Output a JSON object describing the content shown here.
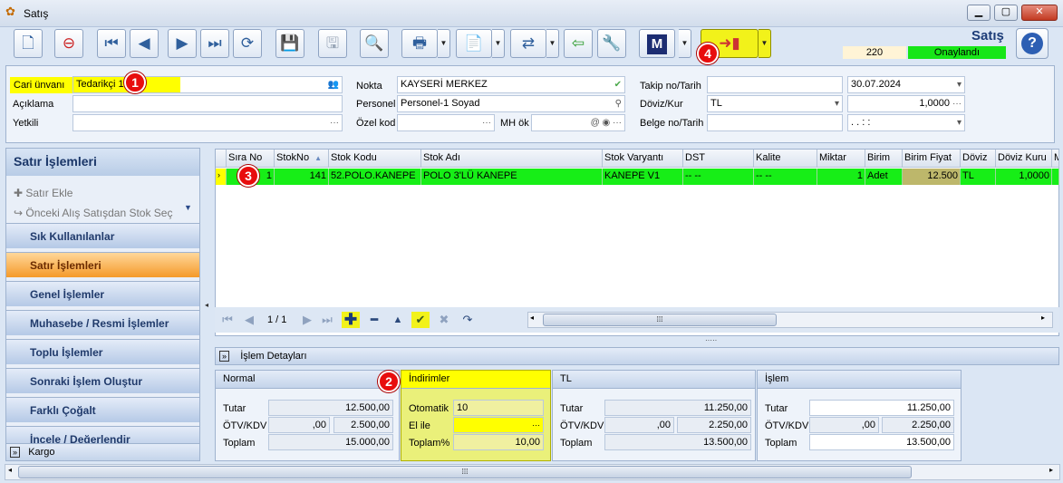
{
  "window": {
    "title": "Satış",
    "minimize": "▁",
    "maximize": "▢",
    "close": "✕"
  },
  "toolbar": {
    "doc_title": "Satış",
    "status_number": "220",
    "status_label": "Onaylandı",
    "m_label": "M",
    "help": "?"
  },
  "header": {
    "cari_label": "Cari ünvanı",
    "cari_value": "Tedarikçi 1",
    "aciklama_label": "Açıklama",
    "aciklama_value": "",
    "yetkili_label": "Yetkili",
    "yetkili_value": "",
    "nokta_label": "Nokta",
    "nokta_value": "KAYSERİ MERKEZ",
    "personel_label": "Personel",
    "personel_value": "Personel-1 Soyad",
    "ozelkod_label": "Özel kod",
    "ozelkod_value": "",
    "mhok_label": "MH ök",
    "mhok_value": "",
    "takip_label": "Takip no/Tarih",
    "takip_value": "",
    "takip_date": "30.07.2024",
    "doviz_label": "Döviz/Kur",
    "doviz_value": "TL",
    "kur_value": "1,0000",
    "belge_label": "Belge no/Tarih",
    "belge_value": "",
    "belge_date": ". .    :  :"
  },
  "left_panel": {
    "title": "Satır İşlemleri",
    "actions": [
      "Satır Ekle",
      "Önceki Alış Satışdan Stok Seç"
    ],
    "nav": [
      "Sık Kullanılanlar",
      "Satır İşlemleri",
      "Genel İşlemler",
      "Muhasebe / Resmi İşlemler",
      "Toplu İşlemler",
      "Sonraki İşlem Oluştur",
      "Farklı Çoğalt",
      "İncele / Değerlendir"
    ],
    "kargo": "Kargo"
  },
  "grid": {
    "columns": [
      "Sıra No",
      "StokNo",
      "Stok Kodu",
      "Stok Adı",
      "Stok Varyantı",
      "DST",
      "Kalite",
      "Miktar",
      "Birim",
      "Birim Fiyat",
      "Döviz",
      "Döviz Kuru",
      "M"
    ],
    "row": [
      "1",
      "141",
      "52.POLO.KANEPE",
      "POLO 3'LÜ KANEPE",
      "KANEPE V1",
      "-- --",
      "-- --",
      "1",
      "Adet",
      "12.500",
      "TL",
      "1,0000",
      ""
    ],
    "pager": "1 / 1"
  },
  "details": {
    "bar_label": "İşlem Detayları",
    "normal": {
      "title": "Normal",
      "tutar_label": "Tutar",
      "tutar": "12.500,00",
      "otv_label": "ÖTV/KDV",
      "otv": ",00",
      "kdv": "2.500,00",
      "toplam_label": "Toplam",
      "toplam": "15.000,00"
    },
    "indirim": {
      "title": "İndirimler",
      "otomatik_label": "Otomatik",
      "otomatik": "10",
      "elile_label": "El ile",
      "elile": "",
      "toplam_label": "Toplam%",
      "toplam": "10,00"
    },
    "tl": {
      "title": "TL",
      "tutar_label": "Tutar",
      "tutar": "11.250,00",
      "otv_label": "ÖTV/KDV",
      "otv": ",00",
      "kdv": "2.250,00",
      "toplam_label": "Toplam",
      "toplam": "13.500,00"
    },
    "islem": {
      "title": "İşlem",
      "tutar_label": "Tutar",
      "tutar": "11.250,00",
      "otv_label": "ÖTV/KDV",
      "otv": ",00",
      "kdv": "2.250,00",
      "toplam_label": "Toplam",
      "toplam": "13.500,00"
    }
  },
  "markers": [
    "1",
    "2",
    "3",
    "4"
  ],
  "colors": {
    "highlight": "#ffff00",
    "row_green": "#17ee17",
    "status_green": "#17e617",
    "marker_red": "#e80d0d"
  }
}
